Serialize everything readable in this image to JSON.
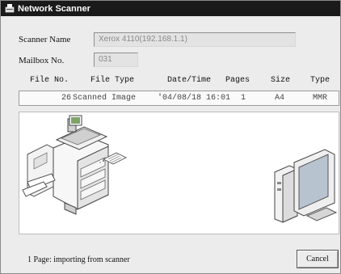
{
  "window": {
    "title": "Network Scanner"
  },
  "form": {
    "scanner_name_label": "Scanner Name",
    "scanner_name_value": "Xerox 4110(192.168.1.1)",
    "mailbox_label": "Mailbox No.",
    "mailbox_value": "031"
  },
  "table": {
    "columns": [
      "File No.",
      "File Type",
      "Date/Time",
      "Pages",
      "Size",
      "Type"
    ],
    "rows": [
      {
        "file_no": "26",
        "file_type": "Scanned Image",
        "date_time": "'04/08/18 16:01",
        "pages": "1",
        "size": "A4",
        "type": "MMR"
      }
    ]
  },
  "illustration": {
    "items": [
      "printer-icon",
      "paper-sheet-icon",
      "computer-icon"
    ]
  },
  "status": {
    "text": "1 Page: importing from scanner"
  },
  "buttons": {
    "cancel": "Cancel"
  },
  "colors": {
    "titlebar": "#1a1a1a",
    "window_bg": "#ececec",
    "scene_bg": "#ffffff"
  }
}
